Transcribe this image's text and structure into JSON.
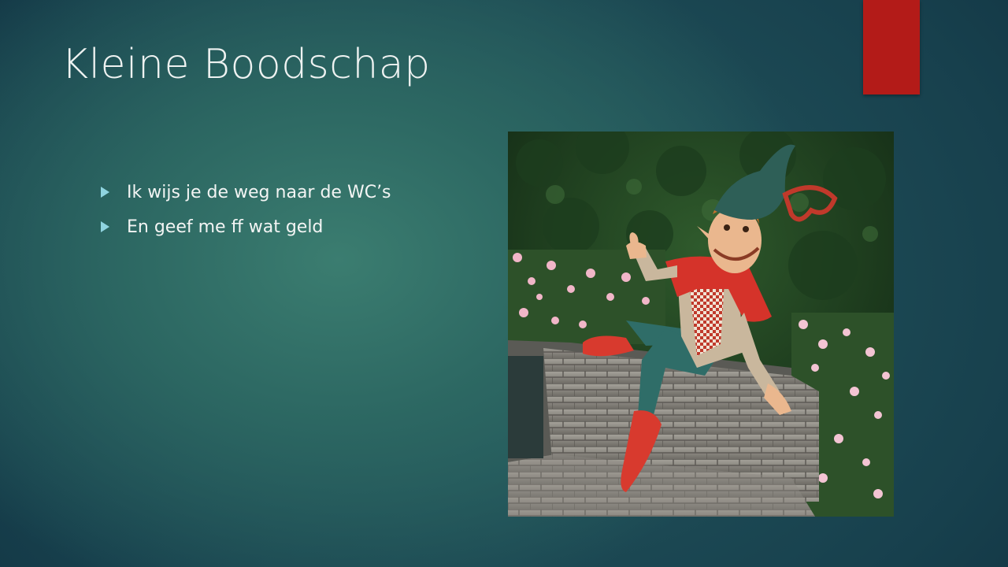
{
  "slide": {
    "title": "Kleine Boodschap",
    "bullets": [
      {
        "text": "Ik wijs je de weg naar de WC’s"
      },
      {
        "text": "En geef me ff wat geld"
      }
    ],
    "image": {
      "alt": "Statue of a jester-like elf in a green hat and red shoes giving a thumbs up, sitting on a brick wall in front of a hedge and flowers"
    }
  },
  "colors": {
    "accent_bar": "#b31b18",
    "bullet_marker": "#8fd4e0",
    "title_text": "#eef2f1"
  }
}
